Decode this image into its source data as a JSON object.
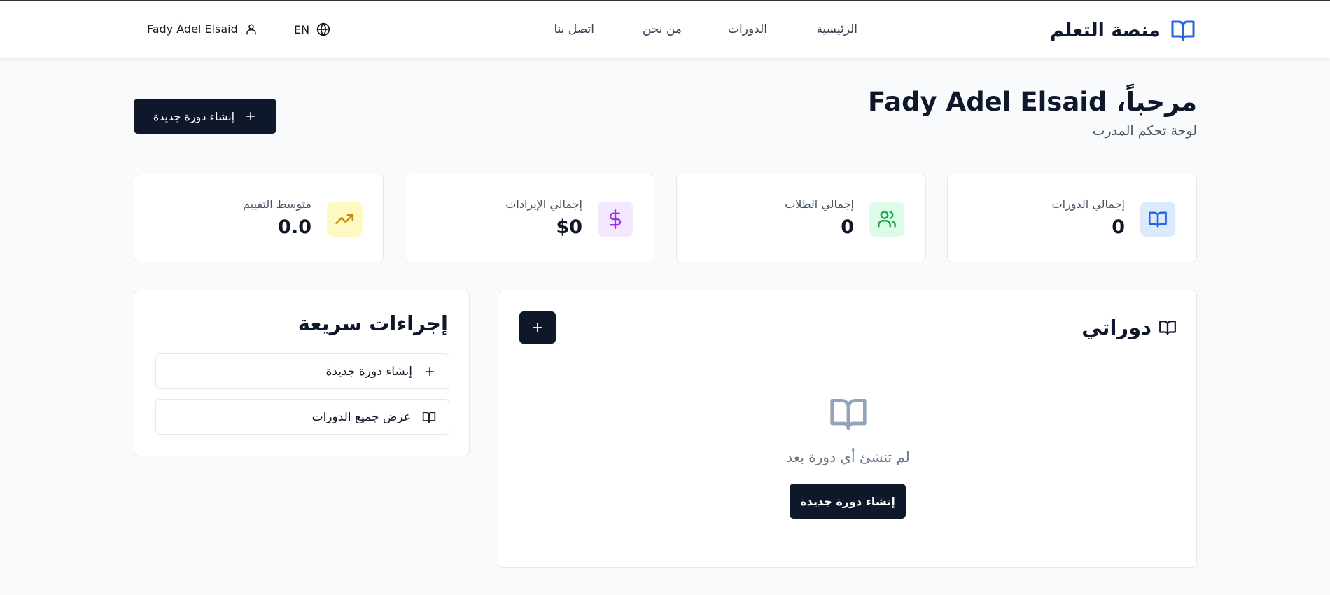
{
  "header": {
    "brand": "منصة التعلم",
    "nav": [
      {
        "label": "الرئيسية"
      },
      {
        "label": "الدورات"
      },
      {
        "label": "من نحن"
      },
      {
        "label": "اتصل بنا"
      }
    ],
    "language": "EN",
    "user_name": "Fady Adel Elsaid"
  },
  "welcome": {
    "title": "مرحباً، Fady Adel Elsaid",
    "subtitle": "لوحة تحكم المدرب",
    "create_button": "إنشاء دورة جديدة"
  },
  "stats": [
    {
      "label": "إجمالي الدورات",
      "value": "0",
      "icon": "book-icon",
      "color": "#2563eb",
      "bg": "#dbeafe"
    },
    {
      "label": "إجمالي الطلاب",
      "value": "0",
      "icon": "users-icon",
      "color": "#16a34a",
      "bg": "#dcfce7"
    },
    {
      "label": "إجمالي الإيرادات",
      "value": "$0",
      "icon": "dollar-icon",
      "color": "#9333ea",
      "bg": "#f3e8ff"
    },
    {
      "label": "متوسط التقييم",
      "value": "0.0",
      "icon": "trending-up-icon",
      "color": "#ca8a04",
      "bg": "#fef9c3"
    }
  ],
  "courses": {
    "title": "دوراتي",
    "add_button": "+",
    "empty_text": "لم تنشئ أي دورة بعد",
    "create_button": "إنشاء دورة جديدة"
  },
  "quick_actions": {
    "title": "إجراءات سريعة",
    "items": [
      {
        "label": "إنشاء دورة جديدة",
        "icon": "plus-icon"
      },
      {
        "label": "عرض جميع الدورات",
        "icon": "book-icon"
      }
    ]
  }
}
